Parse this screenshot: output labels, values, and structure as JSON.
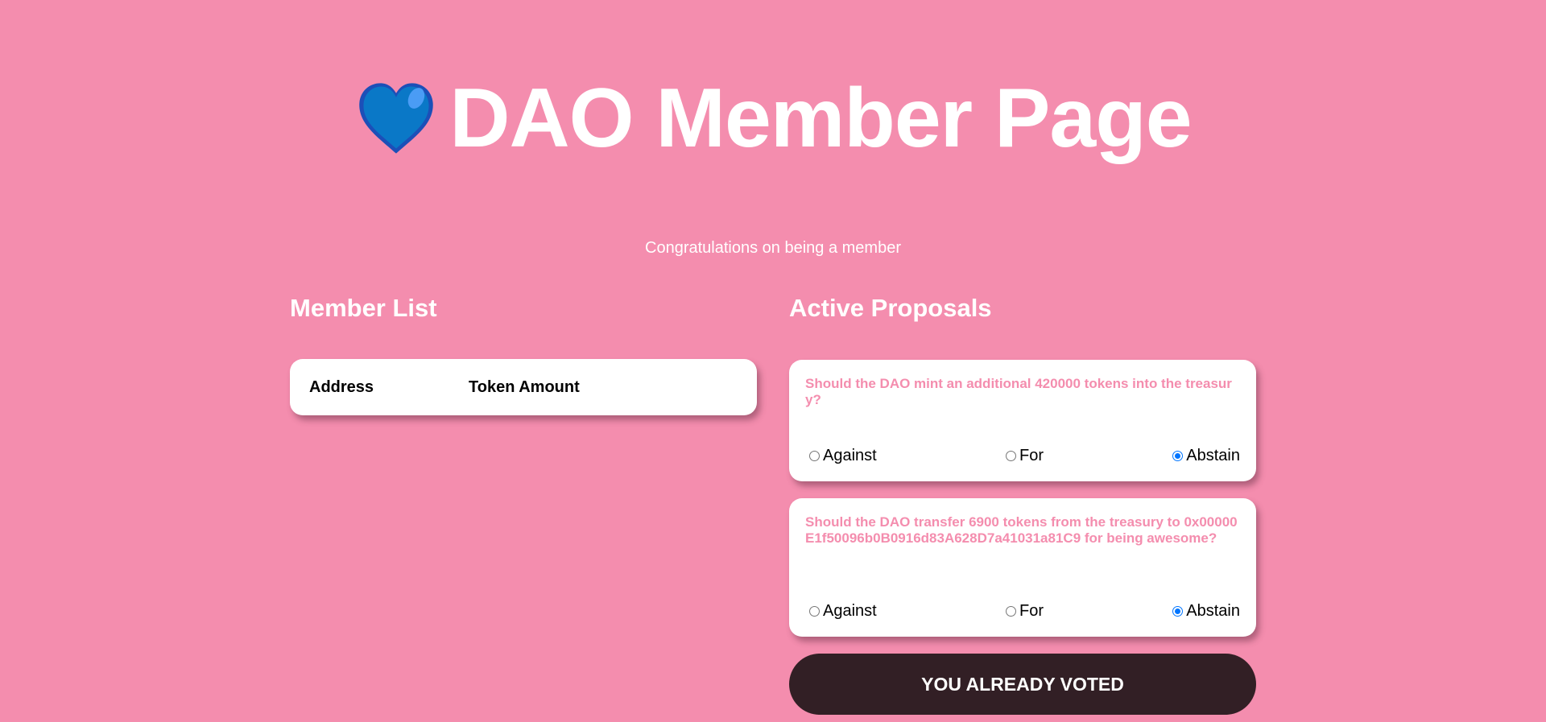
{
  "header": {
    "icon": "blue-heart-icon",
    "title": "DAO Member Page",
    "subtitle": "Congratulations on being a member"
  },
  "member_list": {
    "title": "Member List",
    "columns": [
      "Address",
      "Token Amount"
    ]
  },
  "proposals": {
    "title": "Active Proposals",
    "items": [
      {
        "description": "Should the DAO mint an additional 420000 tokens into the treasury?",
        "options": [
          {
            "label": "Against",
            "selected": false
          },
          {
            "label": "For",
            "selected": false
          },
          {
            "label": "Abstain",
            "selected": true
          }
        ]
      },
      {
        "description": "Should the DAO transfer 6900 tokens from the treasury to 0x00000E1f50096b0B0916d83A628D7a41031a81C9 for being awesome?",
        "options": [
          {
            "label": "Against",
            "selected": false
          },
          {
            "label": "For",
            "selected": false
          },
          {
            "label": "Abstain",
            "selected": true
          }
        ]
      }
    ]
  },
  "vote_button": {
    "label": "YOU ALREADY VOTED"
  },
  "colors": {
    "background": "#f48dae",
    "accent_text": "#f48dae",
    "button": "#321f25",
    "radio_checked": "#0075ff"
  }
}
